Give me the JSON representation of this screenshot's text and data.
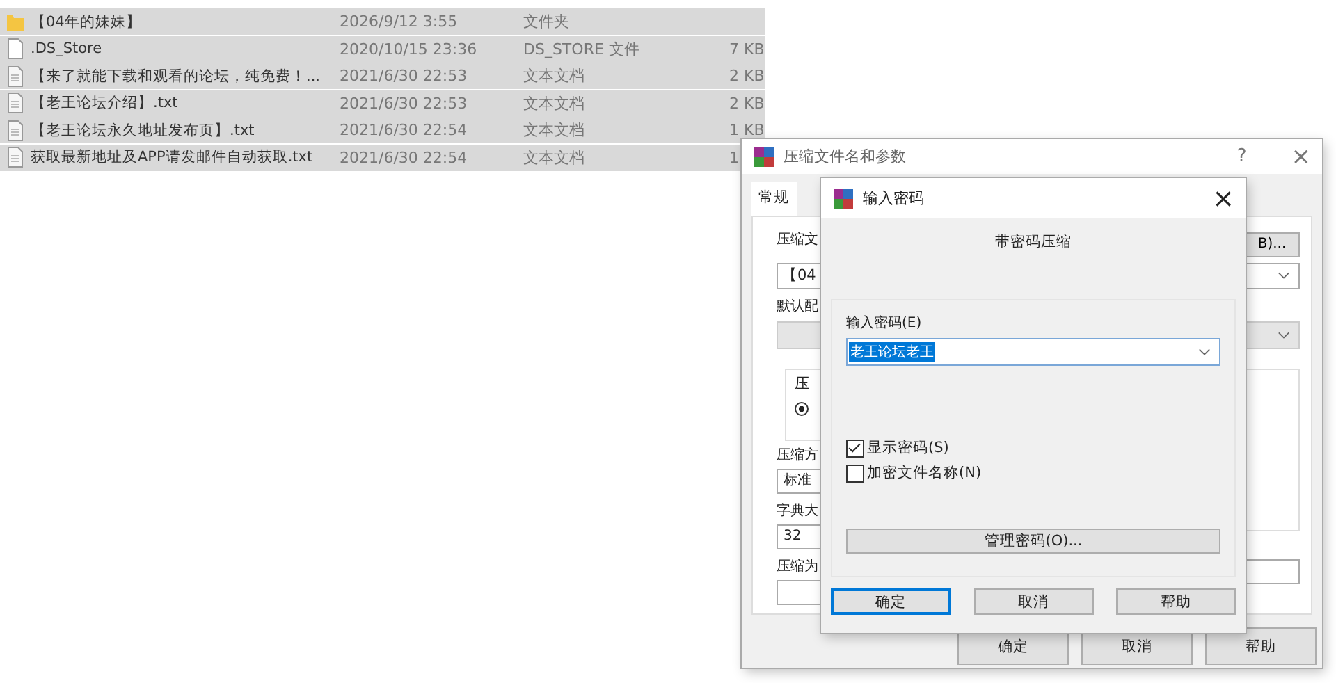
{
  "files": [
    {
      "kind": "folder",
      "name": "【04年的妹妹】",
      "date": "2026/9/12 3:55",
      "type": "文件夹",
      "selected": true
    },
    {
      "kind": "file",
      "name": ".DS_Store",
      "date": "2020/10/15 23:36",
      "type": "DS_STORE 文件",
      "size": "7 KB",
      "selected": true
    },
    {
      "kind": "text",
      "name": "【来了就能下载和观看的论坛，纯免费！...",
      "date": "2021/6/30 22:53",
      "type": "文本文档",
      "size": "2 KB",
      "selected": true
    },
    {
      "kind": "text",
      "name": "【老王论坛介绍】.txt",
      "date": "2021/6/30 22:53",
      "type": "文本文档",
      "size": "2 KB",
      "selected": true
    },
    {
      "kind": "text",
      "name": "【老王论坛永久地址发布页】.txt",
      "date": "2021/6/30 22:54",
      "type": "文本文档",
      "size": "1 KB",
      "selected": true
    },
    {
      "kind": "text",
      "name": "获取最新地址及APP请发邮件自动获取.txt",
      "date": "2021/6/30 22:54",
      "type": "文本文档",
      "size": "1",
      "selected": true
    }
  ],
  "archive_dialog": {
    "title": "压缩文件名和参数",
    "help": "?",
    "close": "×",
    "tab": {
      "label": "常规",
      "selected": true
    },
    "archive_name_label": "压缩文",
    "archive_name_value": "【04",
    "browse_button": "B)...",
    "profile_label": "默认配",
    "format_group_label": "压",
    "radio_selected": true,
    "method_label": "压缩方",
    "method_value": "标准",
    "dict_label": "字典大",
    "dict_value": "32",
    "split_label": "压缩为",
    "buttons": [
      "确定",
      "取消",
      "帮助"
    ]
  },
  "password_dialog": {
    "title": "输入密码",
    "close": "×",
    "heading": "带密码压缩",
    "field_label": "输入密码(E)",
    "password": "老王论坛老王",
    "options": [
      {
        "label": "显示密码(S)",
        "checked": true
      },
      {
        "label": "加密文件名称(N)",
        "checked": false
      }
    ],
    "manage_button": "管理密码(O)...",
    "buttons": [
      {
        "label": "确定",
        "focused": true
      },
      {
        "label": "取消",
        "focused": false
      },
      {
        "label": "帮助",
        "focused": false
      }
    ]
  }
}
